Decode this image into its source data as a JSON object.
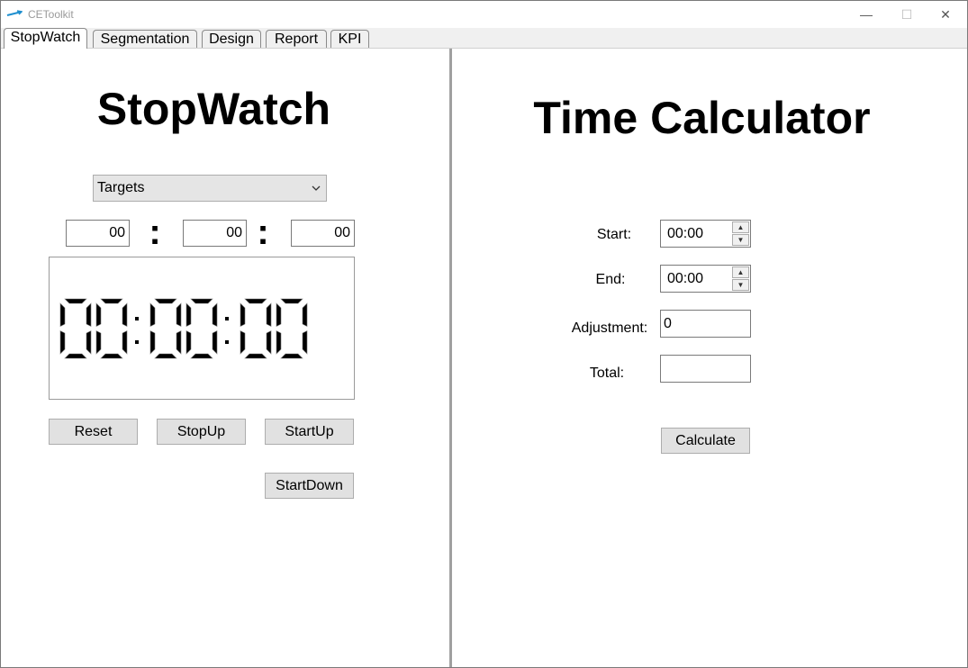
{
  "window": {
    "title": "CEToolkit",
    "minimize": "—",
    "maximize": "☐",
    "close": "✕"
  },
  "tabs": [
    {
      "label": "StopWatch",
      "active": true
    },
    {
      "label": "Segmentation",
      "active": false
    },
    {
      "label": "Design",
      "active": false
    },
    {
      "label": "Report",
      "active": false
    },
    {
      "label": "KPI",
      "active": false
    }
  ],
  "stopwatch": {
    "title": "StopWatch",
    "dropdown": {
      "selected": "Targets",
      "icon": "chevron-down-icon"
    },
    "hours_input": "00",
    "minutes_input": "00",
    "seconds_input": "00",
    "separator": ":",
    "display": "00:00:00",
    "buttons": {
      "reset": "Reset",
      "stop_up": "StopUp",
      "start_up": "StartUp",
      "start_down": "StartDown"
    }
  },
  "calculator": {
    "title": "Time Calculator",
    "start_label": "Start:",
    "start_value": "00:00",
    "end_label": "End:",
    "end_value": "00:00",
    "adjustment_label": "Adjustment:",
    "adjustment_value": "0",
    "total_label": "Total:",
    "total_value": "",
    "calculate_button": "Calculate"
  },
  "colors": {
    "accent_icon": "#1e8fcf",
    "button_bg": "#e1e1e1",
    "divider": "#a0a0a0"
  }
}
